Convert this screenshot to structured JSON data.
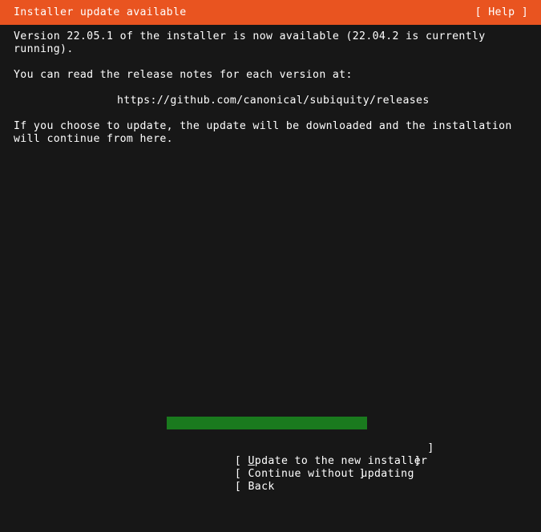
{
  "header": {
    "title": "Installer update available",
    "help_label": "[ Help ]",
    "background_color": "#e95420",
    "text_color": "#ffffff"
  },
  "screen": {
    "background_color": "#171717",
    "text_color": "#ffffff"
  },
  "content": {
    "paragraph_1": "Version 22.05.1 of the installer is now available (22.04.2 is currently\nrunning).",
    "paragraph_2": "You can read the release notes for each version at:",
    "release_notes_url": "https://github.com/canonical/subiquity/releases",
    "paragraph_3": "If you choose to update, the update will be downloaded and the installation\nwill continue from here."
  },
  "buttons": {
    "selected_index": 0,
    "selected_background_color": "#1a7a1e",
    "items": [
      {
        "bracket_open": "[",
        "accelerator": "U",
        "label_rest": "pdate to the new installer",
        "bracket_close": "]",
        "selected": true
      },
      {
        "bracket_open": "[",
        "accelerator": "",
        "label_rest": "Continue without updating",
        "bracket_close": "]",
        "selected": false
      },
      {
        "bracket_open": "[",
        "accelerator": "",
        "label_rest": "Back",
        "bracket_close": "]",
        "selected": false
      }
    ]
  }
}
